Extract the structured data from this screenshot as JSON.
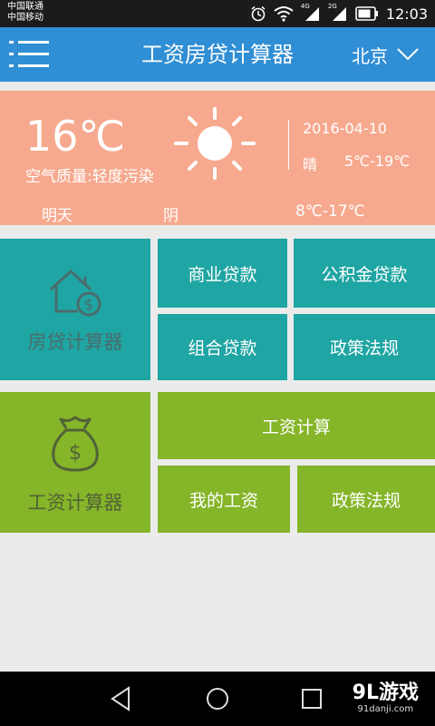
{
  "status_bar": {
    "carrier_1": "中国联通",
    "carrier_2": "中国移动",
    "net_1": "4G",
    "net_2": "2G",
    "time": "12:03"
  },
  "app_bar": {
    "title": "工资房贷计算器",
    "city": "北京"
  },
  "weather": {
    "temperature": "16℃",
    "air_quality": "空气质量:轻度污染",
    "date": "2016-04-10",
    "condition": "晴",
    "temp_range": "5℃-19℃",
    "icon": "sun-icon",
    "tomorrow": {
      "label": "明天",
      "condition": "阴",
      "temp_range": "8℃-17℃"
    }
  },
  "mortgage": {
    "label": "房贷计算器",
    "icon": "house-money-icon",
    "items": [
      "商业贷款",
      "公积金贷款",
      "组合贷款",
      "政策法规"
    ]
  },
  "salary": {
    "label": "工资计算器",
    "icon": "money-bag-icon",
    "items": [
      "工资计算",
      "我的工资",
      "政策法规"
    ]
  },
  "watermark": {
    "logo": "9L游戏",
    "url": "91danji.com"
  },
  "colors": {
    "status_bar": "#1b1b1b",
    "app_bar": "#2f8ed4",
    "weather_card": "#f6a98e",
    "mortgage_tiles": "#1fa5a3",
    "salary_tiles": "#85b528",
    "background": "#ebebeb"
  }
}
